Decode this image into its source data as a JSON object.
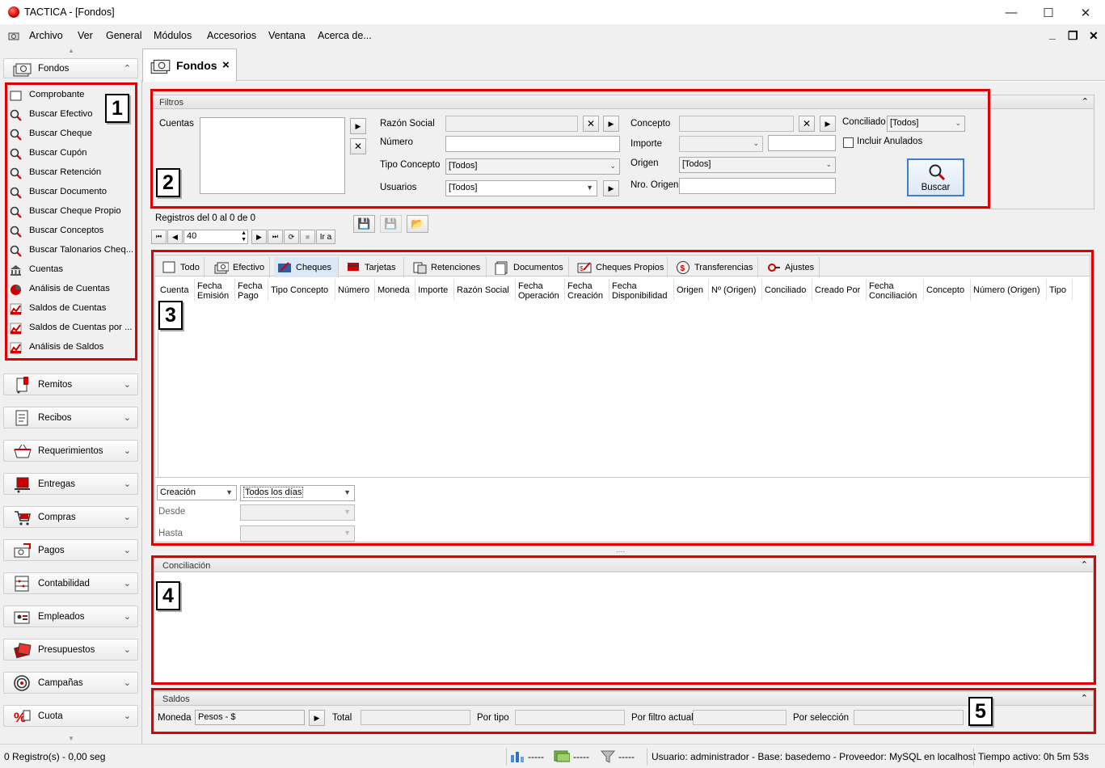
{
  "window": {
    "title": "TACTICA - [Fondos]",
    "min": "—",
    "max": "☐",
    "close": "✕"
  },
  "menu": {
    "items": [
      "Archivo",
      "Ver",
      "General",
      "Módulos",
      "Accesorios",
      "Ventana",
      "Acerca de..."
    ],
    "mdi_min": "_",
    "mdi_restore": "❐",
    "mdi_close": "✕"
  },
  "sidebar": {
    "active_category": "Fondos",
    "items": [
      {
        "label": "Comprobante",
        "icon": "document-icon"
      },
      {
        "label": "Buscar Efectivo",
        "icon": "search-icon"
      },
      {
        "label": "Buscar Cheque",
        "icon": "search-icon"
      },
      {
        "label": "Buscar Cupón",
        "icon": "search-icon"
      },
      {
        "label": "Buscar Retención",
        "icon": "search-icon"
      },
      {
        "label": "Buscar Documento",
        "icon": "search-icon"
      },
      {
        "label": "Buscar Cheque Propio",
        "icon": "search-icon"
      },
      {
        "label": "Buscar Conceptos",
        "icon": "search-icon"
      },
      {
        "label": "Buscar Talonarios Cheq...",
        "icon": "search-icon"
      },
      {
        "label": "Cuentas",
        "icon": "bank-icon"
      },
      {
        "label": "Análisis de Cuentas",
        "icon": "pie-chart-icon"
      },
      {
        "label": "Saldos de Cuentas",
        "icon": "chart-icon"
      },
      {
        "label": "Saldos de Cuentas por ...",
        "icon": "chart-icon"
      },
      {
        "label": "Análisis de Saldos",
        "icon": "chart-icon"
      }
    ],
    "categories": [
      "Remitos",
      "Recibos",
      "Requerimientos",
      "Entregas",
      "Compras",
      "Pagos",
      "Contabilidad",
      "Empleados",
      "Presupuestos",
      "Campañas",
      "Cuota"
    ]
  },
  "doc_tab": {
    "label": "Fondos",
    "close": "×"
  },
  "filtros": {
    "header": "Filtros",
    "cuentas_label": "Cuentas",
    "razon_social_label": "Razón Social",
    "numero_label": "Número",
    "tipo_concepto_label": "Tipo Concepto",
    "tipo_concepto_value": "[Todos]",
    "usuarios_label": "Usuarios",
    "usuarios_value": "[Todos]",
    "concepto_label": "Concepto",
    "importe_label": "Importe",
    "origen_label": "Origen",
    "origen_value": "[Todos]",
    "nro_origen_label": "Nro. Origen",
    "conciliado_label": "Conciliado",
    "conciliado_value": "[Todos]",
    "incluir_anulados": "Incluir Anulados",
    "buscar": "Buscar"
  },
  "records": {
    "text": "Registros del 0 al 0 de 0",
    "page_size": "40",
    "goto": "Ir a"
  },
  "grid": {
    "tabs": [
      {
        "label": "Todo",
        "icon": "document-icon"
      },
      {
        "label": "Efectivo",
        "icon": "cash-icon"
      },
      {
        "label": "Cheques",
        "icon": "cheque-icon"
      },
      {
        "label": "Tarjetas",
        "icon": "card-icon"
      },
      {
        "label": "Retenciones",
        "icon": "retention-icon"
      },
      {
        "label": "Documentos",
        "icon": "documents-icon"
      },
      {
        "label": "Cheques Propios",
        "icon": "own-cheque-icon"
      },
      {
        "label": "Transferencias",
        "icon": "transfer-icon"
      },
      {
        "label": "Ajustes",
        "icon": "adjust-icon"
      }
    ],
    "active_tab": 2,
    "columns": [
      "Cuenta",
      "Fecha Emisión",
      "Fecha Pago",
      "Tipo Concepto",
      "Número",
      "Moneda",
      "Importe",
      "Razón Social",
      "Fecha Operación",
      "Fecha Creación",
      "Fecha Disponibilidad",
      "Origen",
      "Nº (Origen)",
      "Conciliado",
      "Creado Por",
      "Fecha Conciliación",
      "Concepto",
      "Número (Origen)",
      "Tipo"
    ],
    "date_field": "Creación",
    "date_range": "Todos los días",
    "desde_label": "Desde",
    "hasta_label": "Hasta",
    "splitter": "....",
    "tag": "3"
  },
  "conciliacion": {
    "header": "Conciliación",
    "tag": "4"
  },
  "saldos": {
    "header": "Saldos",
    "moneda_label": "Moneda",
    "moneda_value": "Pesos - $",
    "total_label": "Total",
    "por_tipo_label": "Por tipo",
    "por_filtro_label": "Por filtro actual",
    "por_seleccion_label": "Por selección",
    "tag": "5"
  },
  "tags": {
    "sidebar": "1",
    "filtros": "2"
  },
  "status": {
    "left": "0 Registro(s) - 0,00 seg",
    "s1": "-----",
    "s2": "-----",
    "s3": "-----",
    "info": "Usuario: administrador - Base: basedemo - Proveedor: MySQL en localhost",
    "time": "Tiempo activo: 0h 5m 53s"
  },
  "colors": {
    "highlight": "#e00000",
    "accent_button": "#3c7fd1",
    "chart_icon": "#c00000"
  }
}
